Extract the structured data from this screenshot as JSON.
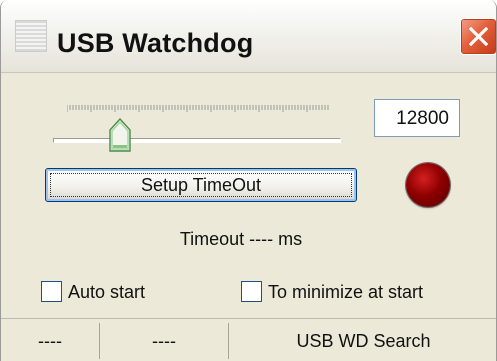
{
  "window": {
    "title": "USB Watchdog"
  },
  "timeout": {
    "value": "12800",
    "setup_label": "Setup TimeOut",
    "status_text": "Timeout ---- ms",
    "led_color": "#8e0000"
  },
  "options": {
    "auto_start": {
      "label": "Auto start",
      "checked": false
    },
    "minimize_at_start": {
      "label": "To minimize at start",
      "checked": false
    }
  },
  "statusbar": {
    "panels": [
      "----",
      "----",
      "USB WD Search"
    ]
  }
}
